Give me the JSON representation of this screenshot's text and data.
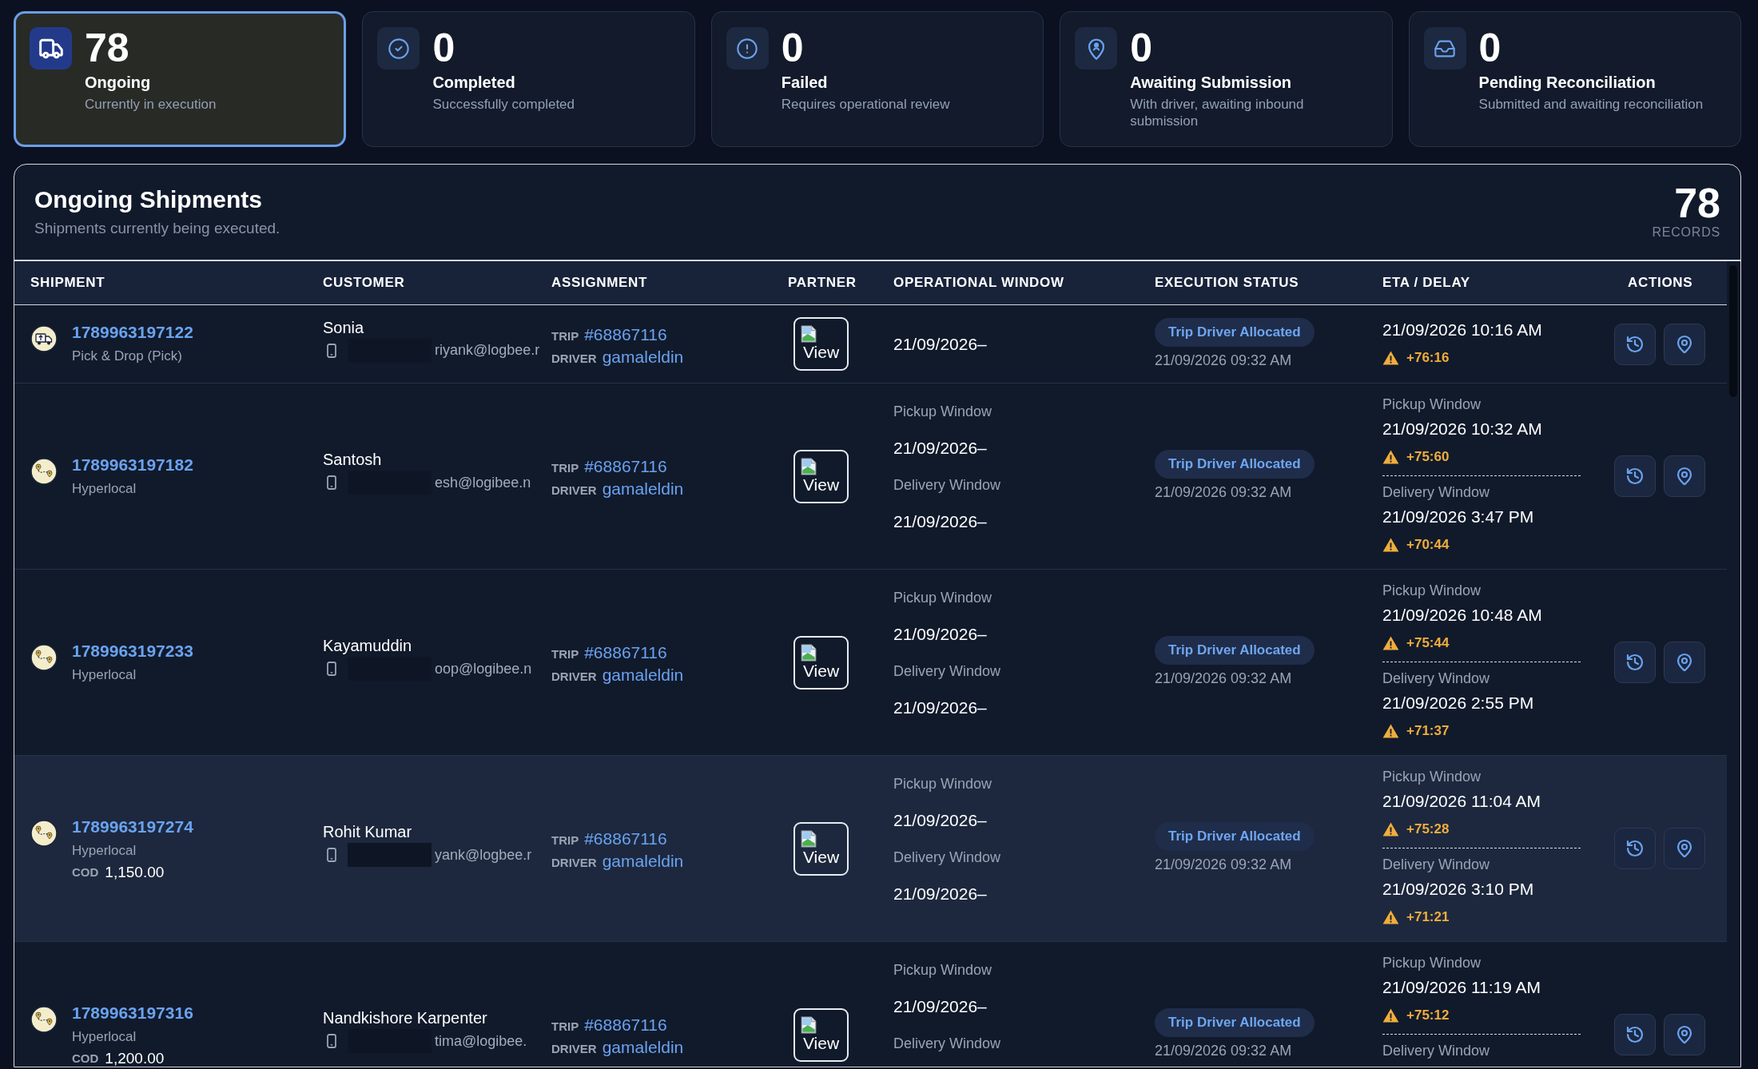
{
  "summary_cards": [
    {
      "kind": "truck",
      "count": "78",
      "title": "Ongoing",
      "description": "Currently in execution",
      "selected": true
    },
    {
      "kind": "check",
      "count": "0",
      "title": "Completed",
      "description": "Successfully completed",
      "selected": false
    },
    {
      "kind": "alert",
      "count": "0",
      "title": "Failed",
      "description": "Requires operational review",
      "selected": false
    },
    {
      "kind": "pin",
      "count": "0",
      "title": "Awaiting Submission",
      "description": "With driver, awaiting inbound submission",
      "selected": false
    },
    {
      "kind": "inbox",
      "count": "0",
      "title": "Pending Reconciliation",
      "description": "Submitted and awaiting reconciliation",
      "selected": false
    }
  ],
  "panel": {
    "title": "Ongoing Shipments",
    "subtitle": "Shipments currently being executed.",
    "record_count": "78",
    "record_label": "RECORDS"
  },
  "table": {
    "columns": [
      "SHIPMENT",
      "CUSTOMER",
      "ASSIGNMENT",
      "PARTNER",
      "OPERATIONAL WINDOW",
      "EXECUTION STATUS",
      "ETA / DELAY",
      "ACTIONS"
    ],
    "rows": [
      {
        "highlighted": false,
        "shipment": {
          "kind": "pick_drop",
          "id": "1789963197122",
          "type": "Pick & Drop (Pick)"
        },
        "customer": {
          "name": "Sonia",
          "email": "riyank@logbee.r"
        },
        "assignment": {
          "trip_label": "TRIP",
          "trip": "#68867116",
          "driver_label": "DRIVER",
          "driver": "gamaleldin"
        },
        "partner": "View",
        "operational_window": [
          {
            "date": "21/09/2026–"
          }
        ],
        "execution": {
          "status": "Trip Driver Allocated",
          "updated": "21/09/2026 09:32 AM"
        },
        "eta": [
          {
            "time": "21/09/2026 10:16 AM",
            "delay": "+76:16"
          }
        ]
      },
      {
        "highlighted": false,
        "shipment": {
          "kind": "hyperlocal",
          "id": "1789963197182",
          "type": "Hyperlocal"
        },
        "customer": {
          "name": "Santosh",
          "email": "esh@logibee.n"
        },
        "assignment": {
          "trip_label": "TRIP",
          "trip": "#68867116",
          "driver_label": "DRIVER",
          "driver": "gamaleldin"
        },
        "partner": "View",
        "operational_window": [
          {
            "label": "Pickup Window",
            "date": "21/09/2026–"
          },
          {
            "label": "Delivery Window",
            "date": "21/09/2026–"
          }
        ],
        "execution": {
          "status": "Trip Driver Allocated",
          "updated": "21/09/2026 09:32 AM"
        },
        "eta": [
          {
            "label": "Pickup Window",
            "time": "21/09/2026 10:32 AM",
            "delay": "+75:60"
          },
          {
            "label": "Delivery Window",
            "time": "21/09/2026 3:47 PM",
            "delay": "+70:44"
          }
        ]
      },
      {
        "highlighted": false,
        "shipment": {
          "kind": "hyperlocal",
          "id": "1789963197233",
          "type": "Hyperlocal"
        },
        "customer": {
          "name": "Kayamuddin",
          "email": "oop@logibee.n"
        },
        "assignment": {
          "trip_label": "TRIP",
          "trip": "#68867116",
          "driver_label": "DRIVER",
          "driver": "gamaleldin"
        },
        "partner": "View",
        "operational_window": [
          {
            "label": "Pickup Window",
            "date": "21/09/2026–"
          },
          {
            "label": "Delivery Window",
            "date": "21/09/2026–"
          }
        ],
        "execution": {
          "status": "Trip Driver Allocated",
          "updated": "21/09/2026 09:32 AM"
        },
        "eta": [
          {
            "label": "Pickup Window",
            "time": "21/09/2026 10:48 AM",
            "delay": "+75:44"
          },
          {
            "label": "Delivery Window",
            "time": "21/09/2026 2:55 PM",
            "delay": "+71:37"
          }
        ]
      },
      {
        "highlighted": true,
        "shipment": {
          "kind": "hyperlocal",
          "id": "1789963197274",
          "type": "Hyperlocal",
          "cod_label": "COD",
          "cod": "1,150.00"
        },
        "customer": {
          "name": "Rohit Kumar",
          "email": "yank@logbee.r"
        },
        "assignment": {
          "trip_label": "TRIP",
          "trip": "#68867116",
          "driver_label": "DRIVER",
          "driver": "gamaleldin"
        },
        "partner": "View",
        "operational_window": [
          {
            "label": "Pickup Window",
            "date": "21/09/2026–"
          },
          {
            "label": "Delivery Window",
            "date": "21/09/2026–"
          }
        ],
        "execution": {
          "status": "Trip Driver Allocated",
          "updated": "21/09/2026 09:32 AM"
        },
        "eta": [
          {
            "label": "Pickup Window",
            "time": "21/09/2026 11:04 AM",
            "delay": "+75:28"
          },
          {
            "label": "Delivery Window",
            "time": "21/09/2026 3:10 PM",
            "delay": "+71:21"
          }
        ]
      },
      {
        "highlighted": false,
        "shipment": {
          "kind": "hyperlocal",
          "id": "1789963197316",
          "type": "Hyperlocal",
          "cod_label": "COD",
          "cod": "1,200.00"
        },
        "customer": {
          "name": "Nandkishore Karpenter",
          "email": "tima@logibee."
        },
        "assignment": {
          "trip_label": "TRIP",
          "trip": "#68867116",
          "driver_label": "DRIVER",
          "driver": "gamaleldin"
        },
        "partner": "View",
        "operational_window": [
          {
            "label": "Pickup Window",
            "date": "21/09/2026–"
          },
          {
            "label": "Delivery Window"
          }
        ],
        "execution": {
          "status": "Trip Driver Allocated",
          "updated": "21/09/2026 09:32 AM"
        },
        "eta": [
          {
            "label": "Pickup Window",
            "time": "21/09/2026 11:19 AM",
            "delay": "+75:12"
          },
          {
            "label": "Delivery Window"
          }
        ]
      }
    ]
  }
}
